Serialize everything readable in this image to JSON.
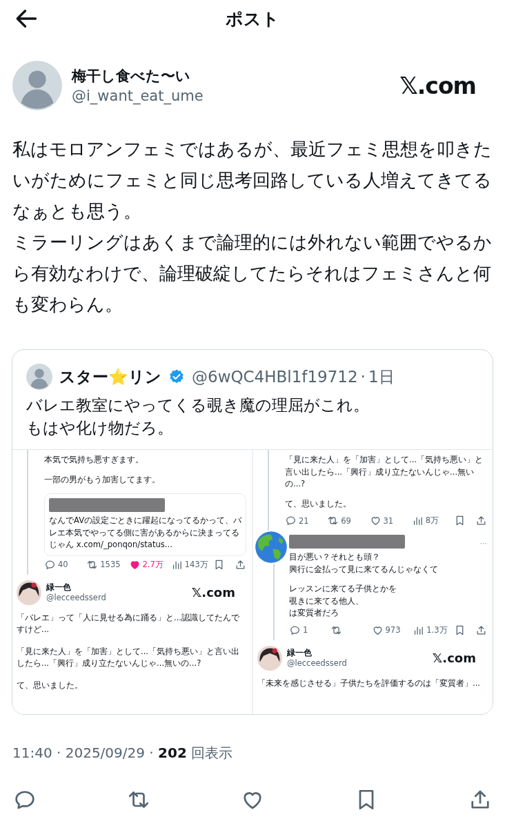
{
  "header": {
    "title": "ポスト"
  },
  "author": {
    "name": "梅干し食べた〜い",
    "handle": "@i_want_eat_ume",
    "logo": "𝕏.com"
  },
  "body": [
    "私はモロアンフェミではあるが、最近フェミ思想を叩きたいがためにフェミと同じ思考回路している人増えてきてるなぁとも思う。",
    "ミラーリングはあくまで論理的には外れない範囲でやるから有効なわけで、論理破綻してたらそれはフェミさんと何も変わらん。"
  ],
  "quote": {
    "name": "スター⭐リン",
    "verified": true,
    "handle": "@6wQC4HBl1f19712",
    "separator": "·",
    "time": "1日",
    "text": [
      "バレエ教室にやってくる覗き魔の理屈がこれ。",
      "もはや化け物だろ。"
    ],
    "images": [
      {
        "blocks": [
          {
            "kind": "thread",
            "items": [
              {
                "kind": "text",
                "text": "本気で気持ち悪すぎます。"
              },
              {
                "kind": "text",
                "text": "一部の男がもう加害してます。"
              },
              {
                "kind": "embed",
                "redacted": true,
                "text": "なんでAVの設定ごときに躍起になってるかって、バレエ本気でやってる側に害があるからに決まってるじゃん x.com/_ponqon/status..."
              },
              {
                "kind": "actions",
                "replies": "40",
                "reposts": "1535",
                "likes": "2.7万",
                "liked": true,
                "views": "143万"
              }
            ]
          },
          {
            "kind": "card",
            "name": "緑一色",
            "handle": "@lecceedsserd",
            "logo": "𝕏.com",
            "paragraphs": [
              "「バレエ」って「人に見せる為に踊る」と...認識してたんですけど...",
              "「見に来た人」を「加害」として...「気持ち悪い」と言い出したら...「興行」成り立たないんじゃ...無いの...?",
              "て、思いました。"
            ]
          }
        ]
      },
      {
        "blocks": [
          {
            "kind": "thread",
            "items": [
              {
                "kind": "text",
                "text": "「見に来た人」を「加害」として...「気持ち悪い」と言い出したら...「興行」成り立たないんじゃ...無いの...?"
              },
              {
                "kind": "text",
                "text": "て、思いました。"
              },
              {
                "kind": "actions",
                "replies": "21",
                "reposts": "69",
                "likes": "31",
                "liked": false,
                "views": "8万"
              }
            ]
          },
          {
            "kind": "reply",
            "redacted": true,
            "more": "···",
            "paragraphs": [
              [
                "目が悪い？それとも頭？",
                "興行に金払って見に来てるんじゃなくて"
              ],
              [
                "レッスンに来てる子供とかを",
                "覗きに来てる他人、",
                "は変質者だろ"
              ]
            ],
            "actions": {
              "replies": "1",
              "likes": "973",
              "liked": false,
              "views": "1.3万"
            }
          },
          {
            "kind": "card",
            "name": "緑一色",
            "handle": "@lecceedsserd",
            "logo": "𝕏.com",
            "paragraphs": [
              "「未来を感じさせる」子供たちを評価するのは「変質者」..."
            ]
          }
        ]
      }
    ]
  },
  "meta": "11:40 · 2025/09/29 · **202** 回表示"
}
